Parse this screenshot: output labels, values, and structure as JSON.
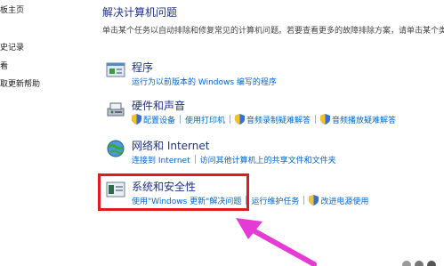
{
  "sidebar": {
    "items": [
      {
        "label": "板主页"
      },
      {
        "label": "史记录"
      },
      {
        "label": "看"
      },
      {
        "label": "取更新帮助"
      }
    ]
  },
  "main": {
    "title": "解决计算机问题",
    "desc_text": "单击某个任务以自动排除和修复常见的计算机问题。若要查看更多的故障排除方案，请单击某个类",
    "desc_link": "别"
  },
  "categories": [
    {
      "title": "程序",
      "icon": "programs-icon",
      "links": [
        "运行为以前版本的 Windows 编写的程序"
      ]
    },
    {
      "title": "硬件和声音",
      "icon": "hardware-sound-icon",
      "links": [
        "配置设备",
        "使用打印机",
        "音频录制疑难解答",
        "音频播放疑难解答"
      ]
    },
    {
      "title": "网络和 Internet",
      "icon": "network-icon",
      "links": [
        "连接到 Internet",
        "访问其他计算机上的共享文件和文件夹"
      ]
    },
    {
      "title": "系统和安全性",
      "icon": "system-security-icon",
      "links": [
        "使用\"Windows 更新\"解决问题",
        "运行维护任务",
        "改进电源使用"
      ]
    }
  ],
  "colors": {
    "highlight": "#e01b1b",
    "arrow": "#e63ad6",
    "link": "#0066cc",
    "heading": "#1e3287"
  }
}
